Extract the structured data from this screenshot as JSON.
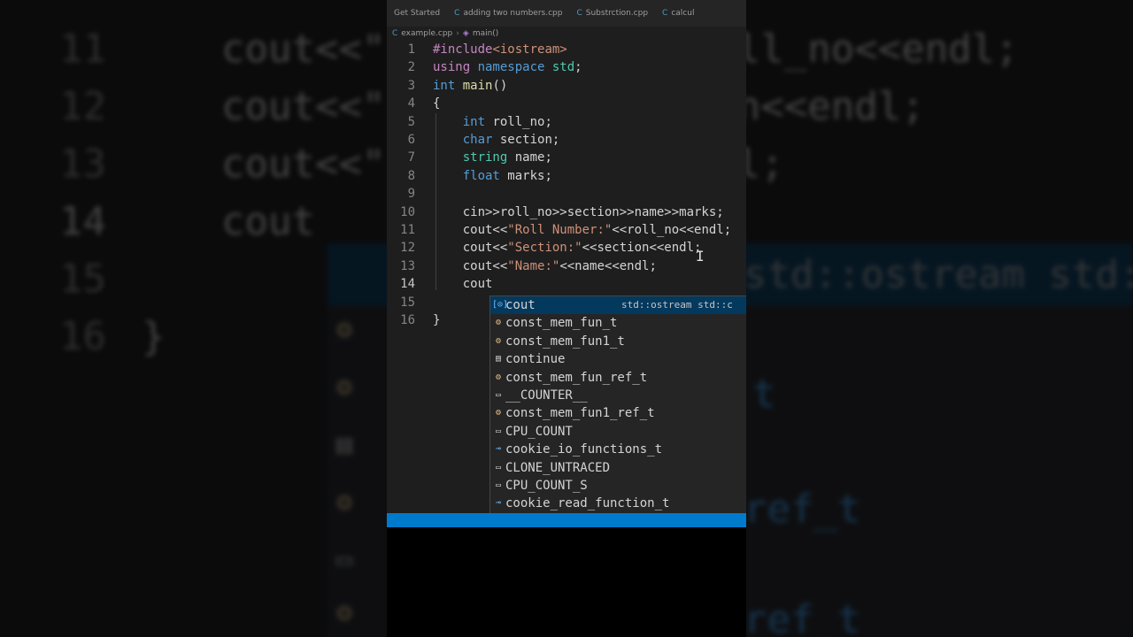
{
  "tabs": [
    {
      "label": "Get Started"
    },
    {
      "label": "adding two numbers.cpp"
    },
    {
      "label": "Substrction.cpp"
    },
    {
      "label": "calcul"
    }
  ],
  "breadcrumb": {
    "file": "example.cpp",
    "symbol": "main()"
  },
  "code_lines": [
    {
      "no": "1",
      "text": "#include<iostream>"
    },
    {
      "no": "2",
      "text": "using namespace std;"
    },
    {
      "no": "3",
      "text": "int main()"
    },
    {
      "no": "4",
      "text": "{"
    },
    {
      "no": "5",
      "text": "    int roll_no;"
    },
    {
      "no": "6",
      "text": "    char section;"
    },
    {
      "no": "7",
      "text": "    string name;"
    },
    {
      "no": "8",
      "text": "    float marks;"
    },
    {
      "no": "9",
      "text": ""
    },
    {
      "no": "10",
      "text": "    cin>>roll_no>>section>>name>>marks;"
    },
    {
      "no": "11",
      "text": "    cout<<\"Roll Number:\"<<roll_no<<endl;"
    },
    {
      "no": "12",
      "text": "    cout<<\"Section:\"<<section<<endl;"
    },
    {
      "no": "13",
      "text": "    cout<<\"Name:\"<<name<<endl;"
    },
    {
      "no": "14",
      "text": "    cout"
    },
    {
      "no": "15",
      "text": ""
    },
    {
      "no": "16",
      "text": "}"
    }
  ],
  "suggestions": [
    {
      "label": "cout",
      "detail": "std::ostream std::c",
      "icon": "variable-icon"
    },
    {
      "label": "const_mem_fun_t",
      "icon": "class-icon"
    },
    {
      "label": "const_mem_fun1_t",
      "icon": "class-icon"
    },
    {
      "label": "continue",
      "icon": "keyword-icon"
    },
    {
      "label": "const_mem_fun_ref_t",
      "icon": "class-icon"
    },
    {
      "label": "__COUNTER__",
      "icon": "macro-icon"
    },
    {
      "label": "const_mem_fun1_ref_t",
      "icon": "class-icon"
    },
    {
      "label": "CPU_COUNT",
      "icon": "macro-icon"
    },
    {
      "label": "cookie_io_functions_t",
      "icon": "typedef-icon"
    },
    {
      "label": "CLONE_UNTRACED",
      "icon": "macro-icon"
    },
    {
      "label": "CPU_COUNT_S",
      "icon": "macro-icon"
    },
    {
      "label": "cookie_read_function_t",
      "icon": "typedef-icon"
    }
  ],
  "colors": {
    "accent": "#007acc",
    "selection": "#04395e",
    "match": "#2aaaff",
    "editor_bg": "#1e1e1e"
  }
}
